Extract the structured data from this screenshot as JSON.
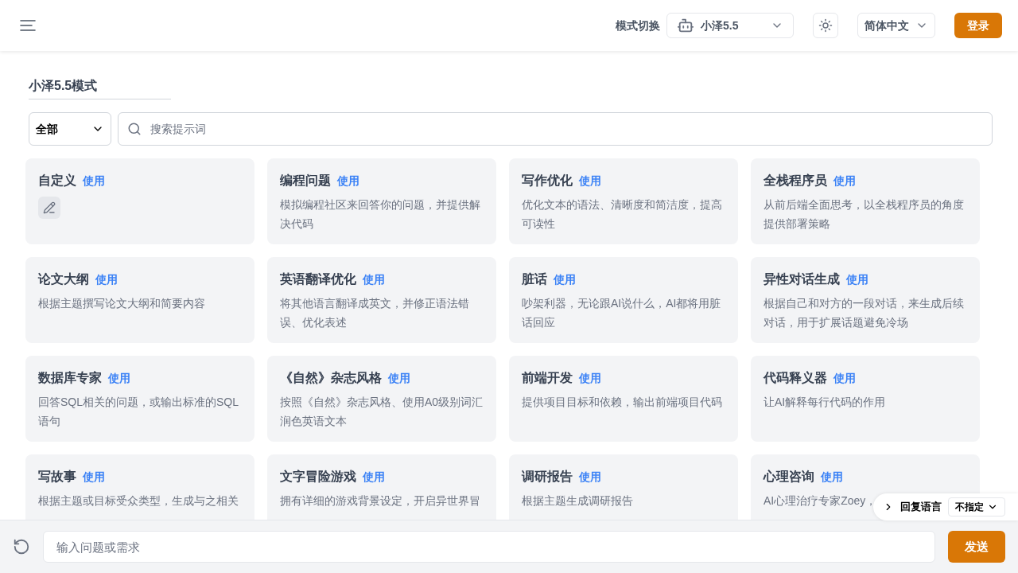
{
  "header": {
    "mode_label": "模式切换",
    "model": "小泽5.5",
    "language": "简体中文",
    "login": "登录"
  },
  "page_title": "小泽5.5模式",
  "filter": {
    "category": "全部",
    "search_placeholder": "搜索提示词"
  },
  "cards": [
    {
      "kind": "custom",
      "title": "自定义",
      "action": "使用"
    },
    {
      "kind": "prompt",
      "title": "编程问题",
      "action": "使用",
      "description": "模拟编程社区来回答你的问题，并提供解决代码"
    },
    {
      "kind": "prompt",
      "title": "写作优化",
      "action": "使用",
      "description": "优化文本的语法、清晰度和简洁度，提高可读性"
    },
    {
      "kind": "prompt",
      "title": "全栈程序员",
      "action": "使用",
      "description": "从前后端全面思考，以全栈程序员的角度提供部署策略"
    },
    {
      "kind": "prompt",
      "title": "论文大纲",
      "action": "使用",
      "description": "根据主题撰写论文大纲和简要内容"
    },
    {
      "kind": "prompt",
      "title": "英语翻译优化",
      "action": "使用",
      "description": "将其他语言翻译成英文，并修正语法错误、优化表述"
    },
    {
      "kind": "prompt",
      "title": "脏话",
      "action": "使用",
      "description": "吵架利器，无论跟AI说什么，AI都将用脏话回应"
    },
    {
      "kind": "prompt",
      "title": "异性对话生成",
      "action": "使用",
      "description": "根据自己和对方的一段对话，来生成后续对话，用于扩展话题避免冷场"
    },
    {
      "kind": "prompt",
      "title": "数据库专家",
      "action": "使用",
      "description": "回答SQL相关的问题，或输出标准的SQL语句"
    },
    {
      "kind": "prompt",
      "title": "《自然》杂志风格",
      "action": "使用",
      "description": "按照《自然》杂志风格、使用A0级别词汇润色英语文本"
    },
    {
      "kind": "prompt",
      "title": "前端开发",
      "action": "使用",
      "description": "提供项目目标和依赖，输出前端项目代码"
    },
    {
      "kind": "prompt",
      "title": "代码释义器",
      "action": "使用",
      "description": "让AI解释每行代码的作用"
    },
    {
      "kind": "prompt",
      "title": "写故事",
      "action": "使用",
      "description": "根据主题或目标受众类型，生成与之相关"
    },
    {
      "kind": "prompt",
      "title": "文字冒险游戏",
      "action": "使用",
      "description": "拥有详细的游戏背景设定，开启异世界冒"
    },
    {
      "kind": "prompt",
      "title": "调研报告",
      "action": "使用",
      "description": "根据主题生成调研报告"
    },
    {
      "kind": "prompt",
      "title": "心理咨询",
      "action": "使用",
      "description": "AI心理治疗专家Zoey，"
    }
  ],
  "reply_language": {
    "label": "回复语言",
    "value": "不指定"
  },
  "composer": {
    "placeholder": "输入问题或需求",
    "send": "发送"
  }
}
